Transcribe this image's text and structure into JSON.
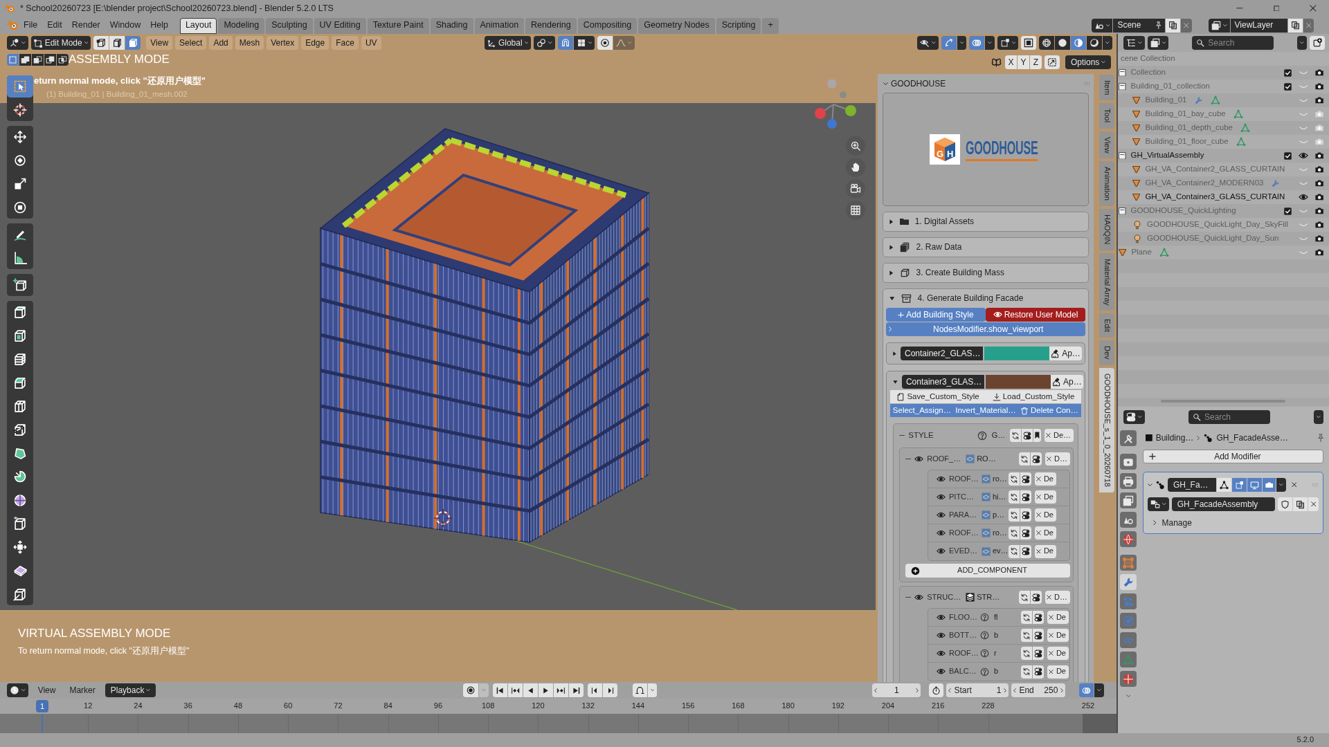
{
  "window": {
    "title": "* School20260723 [E:\\blender project\\School20260723.blend] - Blender 5.2.0 LTS"
  },
  "menu": [
    "File",
    "Edit",
    "Render",
    "Window",
    "Help"
  ],
  "workspaces": [
    {
      "label": "Layout",
      "selected": true
    },
    {
      "label": "Modeling",
      "selected": false
    },
    {
      "label": "Sculpting",
      "selected": false
    },
    {
      "label": "UV Editing",
      "selected": false
    },
    {
      "label": "Texture Paint",
      "selected": false
    },
    {
      "label": "Shading",
      "selected": false
    },
    {
      "label": "Animation",
      "selected": false
    },
    {
      "label": "Rendering",
      "selected": false
    },
    {
      "label": "Compositing",
      "selected": false
    },
    {
      "label": "Geometry Nodes",
      "selected": false
    },
    {
      "label": "Scripting",
      "selected": false
    }
  ],
  "add_workspace": "+",
  "scene": "Scene",
  "view_layer": "ViewLayer",
  "viewport": {
    "mode": "Edit Mode",
    "select_modes": [
      {
        "kind": "vertex",
        "selected": false
      },
      {
        "kind": "edge",
        "selected": false
      },
      {
        "kind": "face",
        "selected": true
      }
    ],
    "menus": [
      "View",
      "Select",
      "Add",
      "Mesh",
      "Vertex",
      "Edge",
      "Face",
      "UV"
    ],
    "orientation": "Global",
    "snap": {
      "on": true
    },
    "proportional": {
      "on": false
    },
    "gizmos": {
      "on": true
    },
    "overlays": {
      "on": true
    },
    "xray": {
      "on": false
    },
    "shading": [
      {
        "kind": "wireframe",
        "selected": false
      },
      {
        "kind": "solid",
        "selected": false
      },
      {
        "kind": "material",
        "selected": true
      },
      {
        "kind": "rendered",
        "selected": false
      }
    ],
    "select_operations": [
      {
        "kind": "new",
        "selected": true
      },
      {
        "kind": "extend",
        "selected": false
      },
      {
        "kind": "subtract",
        "selected": false
      },
      {
        "kind": "difference",
        "selected": false
      },
      {
        "kind": "intersect",
        "selected": false
      }
    ],
    "mode_title": "ASSEMBLY MODE",
    "mirror": [
      {
        "label": "X",
        "on": false
      },
      {
        "label": "Y",
        "on": false
      },
      {
        "label": "Z",
        "on": false
      }
    ],
    "mirror_option": {
      "on": false
    },
    "options": "Options",
    "hint": "eturn normal mode, click \"还原用户模型\"",
    "object_info": "(1) Building_01 | Building_01_mesh.002",
    "tools": [
      [
        {
          "kind": "select-box",
          "selected": true
        },
        {
          "kind": "cursor",
          "selected": false
        }
      ],
      [
        {
          "kind": "move",
          "selected": false
        },
        {
          "kind": "rotate",
          "selected": false
        },
        {
          "kind": "scale",
          "selected": false
        },
        {
          "kind": "transform",
          "selected": false
        }
      ],
      [
        {
          "kind": "annotate",
          "selected": false
        },
        {
          "kind": "measure",
          "selected": false
        }
      ],
      [
        {
          "kind": "add-cube",
          "selected": false
        }
      ],
      [
        {
          "kind": "extrude",
          "selected": false
        },
        {
          "kind": "inset",
          "selected": false
        },
        {
          "kind": "stack",
          "selected": false
        },
        {
          "kind": "bevel",
          "selected": false
        },
        {
          "kind": "loop-cut",
          "selected": false
        },
        {
          "kind": "knife",
          "selected": false
        },
        {
          "kind": "poly-build",
          "selected": false
        },
        {
          "kind": "spin",
          "selected": false
        },
        {
          "kind": "smooth",
          "selected": false
        },
        {
          "kind": "edge-slide",
          "selected": false
        },
        {
          "kind": "shrink",
          "selected": false
        },
        {
          "kind": "shear",
          "selected": false
        },
        {
          "kind": "rip",
          "selected": false
        }
      ]
    ],
    "footer_title": "VIRTUAL ASSEMBLY MODE",
    "footer_hint": "To return normal mode, click \"还原用户模型\""
  },
  "sidebar": {
    "title": "GOODHOUSE",
    "expanded": true,
    "logo": {
      "mark": "GH",
      "text": "GOODHOUSE"
    },
    "sections": [
      {
        "label": "1. Digital Assets",
        "kind": "folder",
        "expanded": false
      },
      {
        "label": "2. Raw Data",
        "kind": "stack",
        "expanded": false
      },
      {
        "label": "3. Create Building Mass",
        "kind": "cube",
        "expanded": false
      },
      {
        "label": "4. Generate Building Facade",
        "kind": "archive",
        "expanded": true,
        "facade": {
          "add_style": "Add Building Style",
          "restore": "Restore User Model",
          "viewport_toggle": "NodesModifier.show_viewport",
          "containers": [
            {
              "name": "Container2_GLAS…",
              "color": "#27a08b",
              "expanded": false,
              "apply": "Ap…"
            },
            {
              "name": "Container3_GLAS…",
              "color": "#6b432f",
              "expanded": true,
              "apply": "Ap…",
              "file_buttons": [
                {
                  "label": "Save_Custom_Style",
                  "kind": "save"
                },
                {
                  "label": "Load_Custom_Style",
                  "kind": "load"
                }
              ],
              "select_buttons": [
                {
                  "label": "Select_Assign…",
                  "kind": "select"
                },
                {
                  "label": "Invert_Material…",
                  "kind": "invert"
                },
                {
                  "label": "Delete Con…",
                  "kind": "delete"
                }
              ],
              "style": {
                "label": "STYLE",
                "expanded": true,
                "value": "G…",
                "delete": "De…",
                "groups": [
                  {
                    "label": "ROOF_…",
                    "kind": "roof",
                    "expanded": true,
                    "visible": true,
                    "value": "RO…",
                    "delete": "D…",
                    "items": [
                      {
                        "label": "ROOF…",
                        "kind": "thumbnail",
                        "visible": true,
                        "value": "ro…",
                        "delete": "De"
                      },
                      {
                        "label": "PITC…",
                        "kind": "thumbnail",
                        "visible": true,
                        "value": "hi…",
                        "delete": "De"
                      },
                      {
                        "label": "PARA…",
                        "kind": "thumbnail",
                        "visible": true,
                        "value": "p…",
                        "delete": "De"
                      },
                      {
                        "label": "ROOF…",
                        "kind": "thumbnail",
                        "visible": true,
                        "value": "ro…",
                        "delete": "De"
                      },
                      {
                        "label": "EVED…",
                        "kind": "thumbnail",
                        "visible": true,
                        "value": "ev…",
                        "delete": "De"
                      }
                    ],
                    "add_component": "ADD_COMPONENT"
                  },
                  {
                    "label": "STRUC…",
                    "kind": "structure",
                    "expanded": true,
                    "visible": true,
                    "value": "STR…",
                    "delete": "D…",
                    "items": [
                      {
                        "label": "FLOO…",
                        "kind": "help",
                        "visible": true,
                        "value": "fl",
                        "delete": "De"
                      },
                      {
                        "label": "BOTT…",
                        "kind": "help",
                        "visible": true,
                        "value": "b",
                        "delete": "De"
                      },
                      {
                        "label": "ROOF…",
                        "kind": "help",
                        "visible": true,
                        "value": "r",
                        "delete": "De"
                      },
                      {
                        "label": "BALC…",
                        "kind": "help",
                        "visible": true,
                        "value": "b",
                        "delete": "De"
                      }
                    ]
                  }
                ]
              }
            }
          ]
        }
      }
    ],
    "tabs": [
      {
        "label": "Item",
        "selected": false
      },
      {
        "label": "Tool",
        "selected": false
      },
      {
        "label": "View",
        "selected": false
      },
      {
        "label": "Animation",
        "selected": false
      },
      {
        "label": "HAOQIN",
        "selected": false
      },
      {
        "label": "Material Array",
        "selected": false
      },
      {
        "label": "Edit",
        "selected": false
      },
      {
        "label": "Dev",
        "selected": false
      },
      {
        "label": "GOODHOUSE_s_1_0_20260718",
        "selected": true
      }
    ]
  },
  "outliner": {
    "search": {
      "placeholder": "Search"
    },
    "tree": [
      {
        "name": "cene Collection",
        "children": [
          {
            "name": "Collection",
            "kind": "collection",
            "checked": true,
            "visible": false,
            "render": true
          },
          {
            "name": "Building_01_collection",
            "kind": "collection",
            "checked": true,
            "visible": false,
            "render": true,
            "children": [
              {
                "name": "Building_01",
                "kind": "object",
                "visible": false,
                "render": true,
                "modifier": true,
                "mesh_data": true
              },
              {
                "name": "Building_01_bay_cube",
                "kind": "object",
                "visible": false,
                "render": false,
                "modifier": false,
                "mesh_data": true
              },
              {
                "name": "Building_01_depth_cube",
                "kind": "object",
                "visible": false,
                "render": false,
                "modifier": false,
                "mesh_data": true
              },
              {
                "name": "Building_01_floor_cube",
                "kind": "object",
                "visible": false,
                "render": false,
                "modifier": false,
                "mesh_data": true
              }
            ]
          },
          {
            "name": "GH_VirtualAssembly",
            "kind": "collection",
            "checked": true,
            "visible": true,
            "render": true,
            "children": [
              {
                "name": "GH_VA_Container2_GLASS_CURTAIN",
                "kind": "object",
                "visible": false,
                "render": true,
                "modifier": false,
                "mesh_data": false
              },
              {
                "name": "GH_VA_Container2_MODERN03",
                "kind": "object",
                "visible": false,
                "render": true,
                "modifier": true,
                "mesh_data": false
              },
              {
                "name": "GH_VA_Container3_GLASS_CURTAIN",
                "kind": "object",
                "visible": true,
                "render": true,
                "modifier": false,
                "mesh_data": false
              }
            ]
          },
          {
            "name": "GOODHOUSE_QuickLighting",
            "kind": "collection",
            "checked": true,
            "visible": false,
            "render": true,
            "children": [
              {
                "name": "GOODHOUSE_QuickLight_Day_SkyFill",
                "kind": "light",
                "visible": false,
                "render": true
              },
              {
                "name": "GOODHOUSE_QuickLight_Day_Sun",
                "kind": "light",
                "visible": false,
                "render": true
              }
            ]
          },
          {
            "name": "Plane",
            "kind": "object",
            "visible": false,
            "render": true,
            "modifier": false,
            "mesh_data": true
          }
        ]
      }
    ]
  },
  "properties": {
    "search": {
      "placeholder": "Search"
    },
    "tabs": [
      [
        {
          "kind": "tool",
          "selected": false
        }
      ],
      [
        {
          "kind": "render",
          "selected": false
        },
        {
          "kind": "output",
          "selected": false
        },
        {
          "kind": "view-layer",
          "selected": false
        },
        {
          "kind": "scene",
          "selected": false
        },
        {
          "kind": "world",
          "selected": false
        }
      ],
      [
        {
          "kind": "object",
          "selected": false
        },
        {
          "kind": "modifier",
          "selected": true
        },
        {
          "kind": "particles",
          "selected": false
        },
        {
          "kind": "physics",
          "selected": false
        },
        {
          "kind": "constraints",
          "selected": false
        },
        {
          "kind": "data",
          "selected": false
        },
        {
          "kind": "material",
          "selected": false
        }
      ]
    ],
    "breadcrumb": [
      "Building…",
      "GH_FacadeAsse…"
    ],
    "add_modifier": "Add Modifier",
    "modifier": {
      "name": "GH_Fa…",
      "expanded": true,
      "toggles": [
        {
          "kind": "edit-mode",
          "on": false
        },
        {
          "kind": "cage",
          "on": true
        },
        {
          "kind": "viewport",
          "on": true
        },
        {
          "kind": "render",
          "on": true
        }
      ],
      "node_group": "GH_FacadeAssembly",
      "manage": {
        "label": "Manage",
        "expanded": false
      }
    }
  },
  "timeline": {
    "menus": [
      "View",
      "Marker"
    ],
    "playback": "Playback",
    "auto_key": {
      "on": false
    },
    "frame": "1",
    "start_label": "Start",
    "start": "1",
    "end_label": "End",
    "end": "250",
    "current_frame": "1",
    "ticks": [
      "12",
      "24",
      "36",
      "48",
      "60",
      "72",
      "84",
      "96",
      "108",
      "120",
      "132",
      "144",
      "156",
      "168",
      "180",
      "192",
      "204",
      "216",
      "228",
      "252"
    ]
  },
  "status_bar": {
    "version": "5.2.0"
  }
}
